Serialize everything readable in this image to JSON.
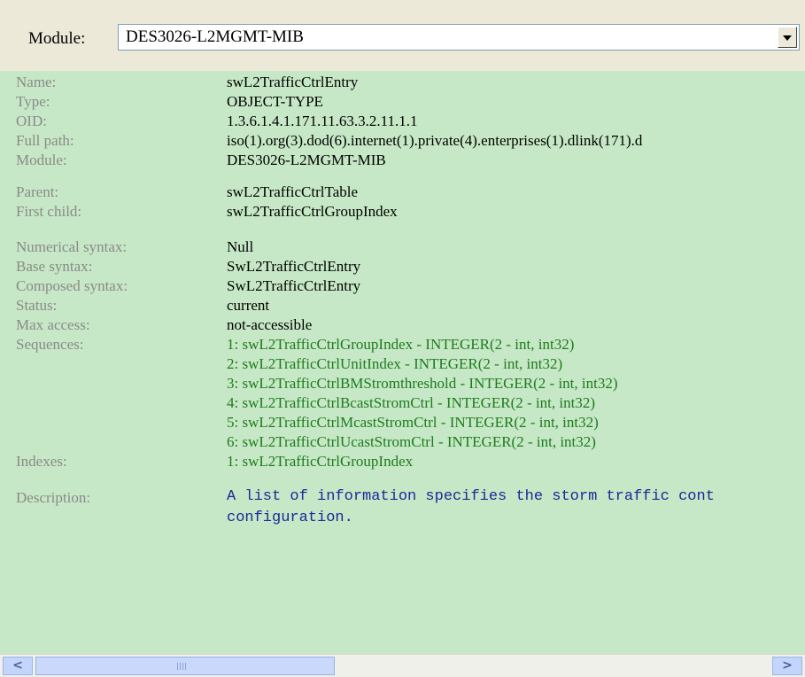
{
  "module_bar": {
    "label": "Module:",
    "selected": "DES3026-L2MGMT-MIB"
  },
  "details": {
    "name_label": "Name:",
    "name": "swL2TrafficCtrlEntry",
    "type_label": "Type:",
    "type": "OBJECT-TYPE",
    "oid_label": "OID:",
    "oid": "1.3.6.1.4.1.171.11.63.3.2.11.1.1",
    "fullpath_label": "Full path:",
    "fullpath": "iso(1).org(3).dod(6).internet(1).private(4).enterprises(1).dlink(171).d",
    "module_label": "Module:",
    "module": "DES3026-L2MGMT-MIB",
    "parent_label": "Parent:",
    "parent": "swL2TrafficCtrlTable",
    "firstchild_label": "First child:",
    "firstchild": "swL2TrafficCtrlGroupIndex",
    "numsyntax_label": "Numerical syntax:",
    "numsyntax": "Null",
    "basesyntax_label": "Base syntax:",
    "basesyntax": "SwL2TrafficCtrlEntry",
    "composedsyntax_label": "Composed syntax:",
    "composedsyntax": "SwL2TrafficCtrlEntry",
    "status_label": "Status:",
    "status": "current",
    "maxaccess_label": "Max access:",
    "maxaccess": "not-accessible",
    "sequences_label": "Sequences:",
    "sequences": [
      "1: swL2TrafficCtrlGroupIndex - INTEGER(2 - int, int32)",
      "2: swL2TrafficCtrlUnitIndex - INTEGER(2 - int, int32)",
      "3: swL2TrafficCtrlBMStromthreshold - INTEGER(2 - int, int32)",
      "4: swL2TrafficCtrlBcastStromCtrl - INTEGER(2 - int, int32)",
      "5: swL2TrafficCtrlMcastStromCtrl - INTEGER(2 - int, int32)",
      "6: swL2TrafficCtrlUcastStromCtrl - INTEGER(2 - int, int32)"
    ],
    "indexes_label": "Indexes:",
    "indexes": "1: swL2TrafficCtrlGroupIndex",
    "description_label": "Description:",
    "description_line1": "A list of information specifies the storm traffic cont",
    "description_line2": "configuration."
  },
  "scrollbar": {
    "left_glyph": "<",
    "right_glyph": ">"
  }
}
